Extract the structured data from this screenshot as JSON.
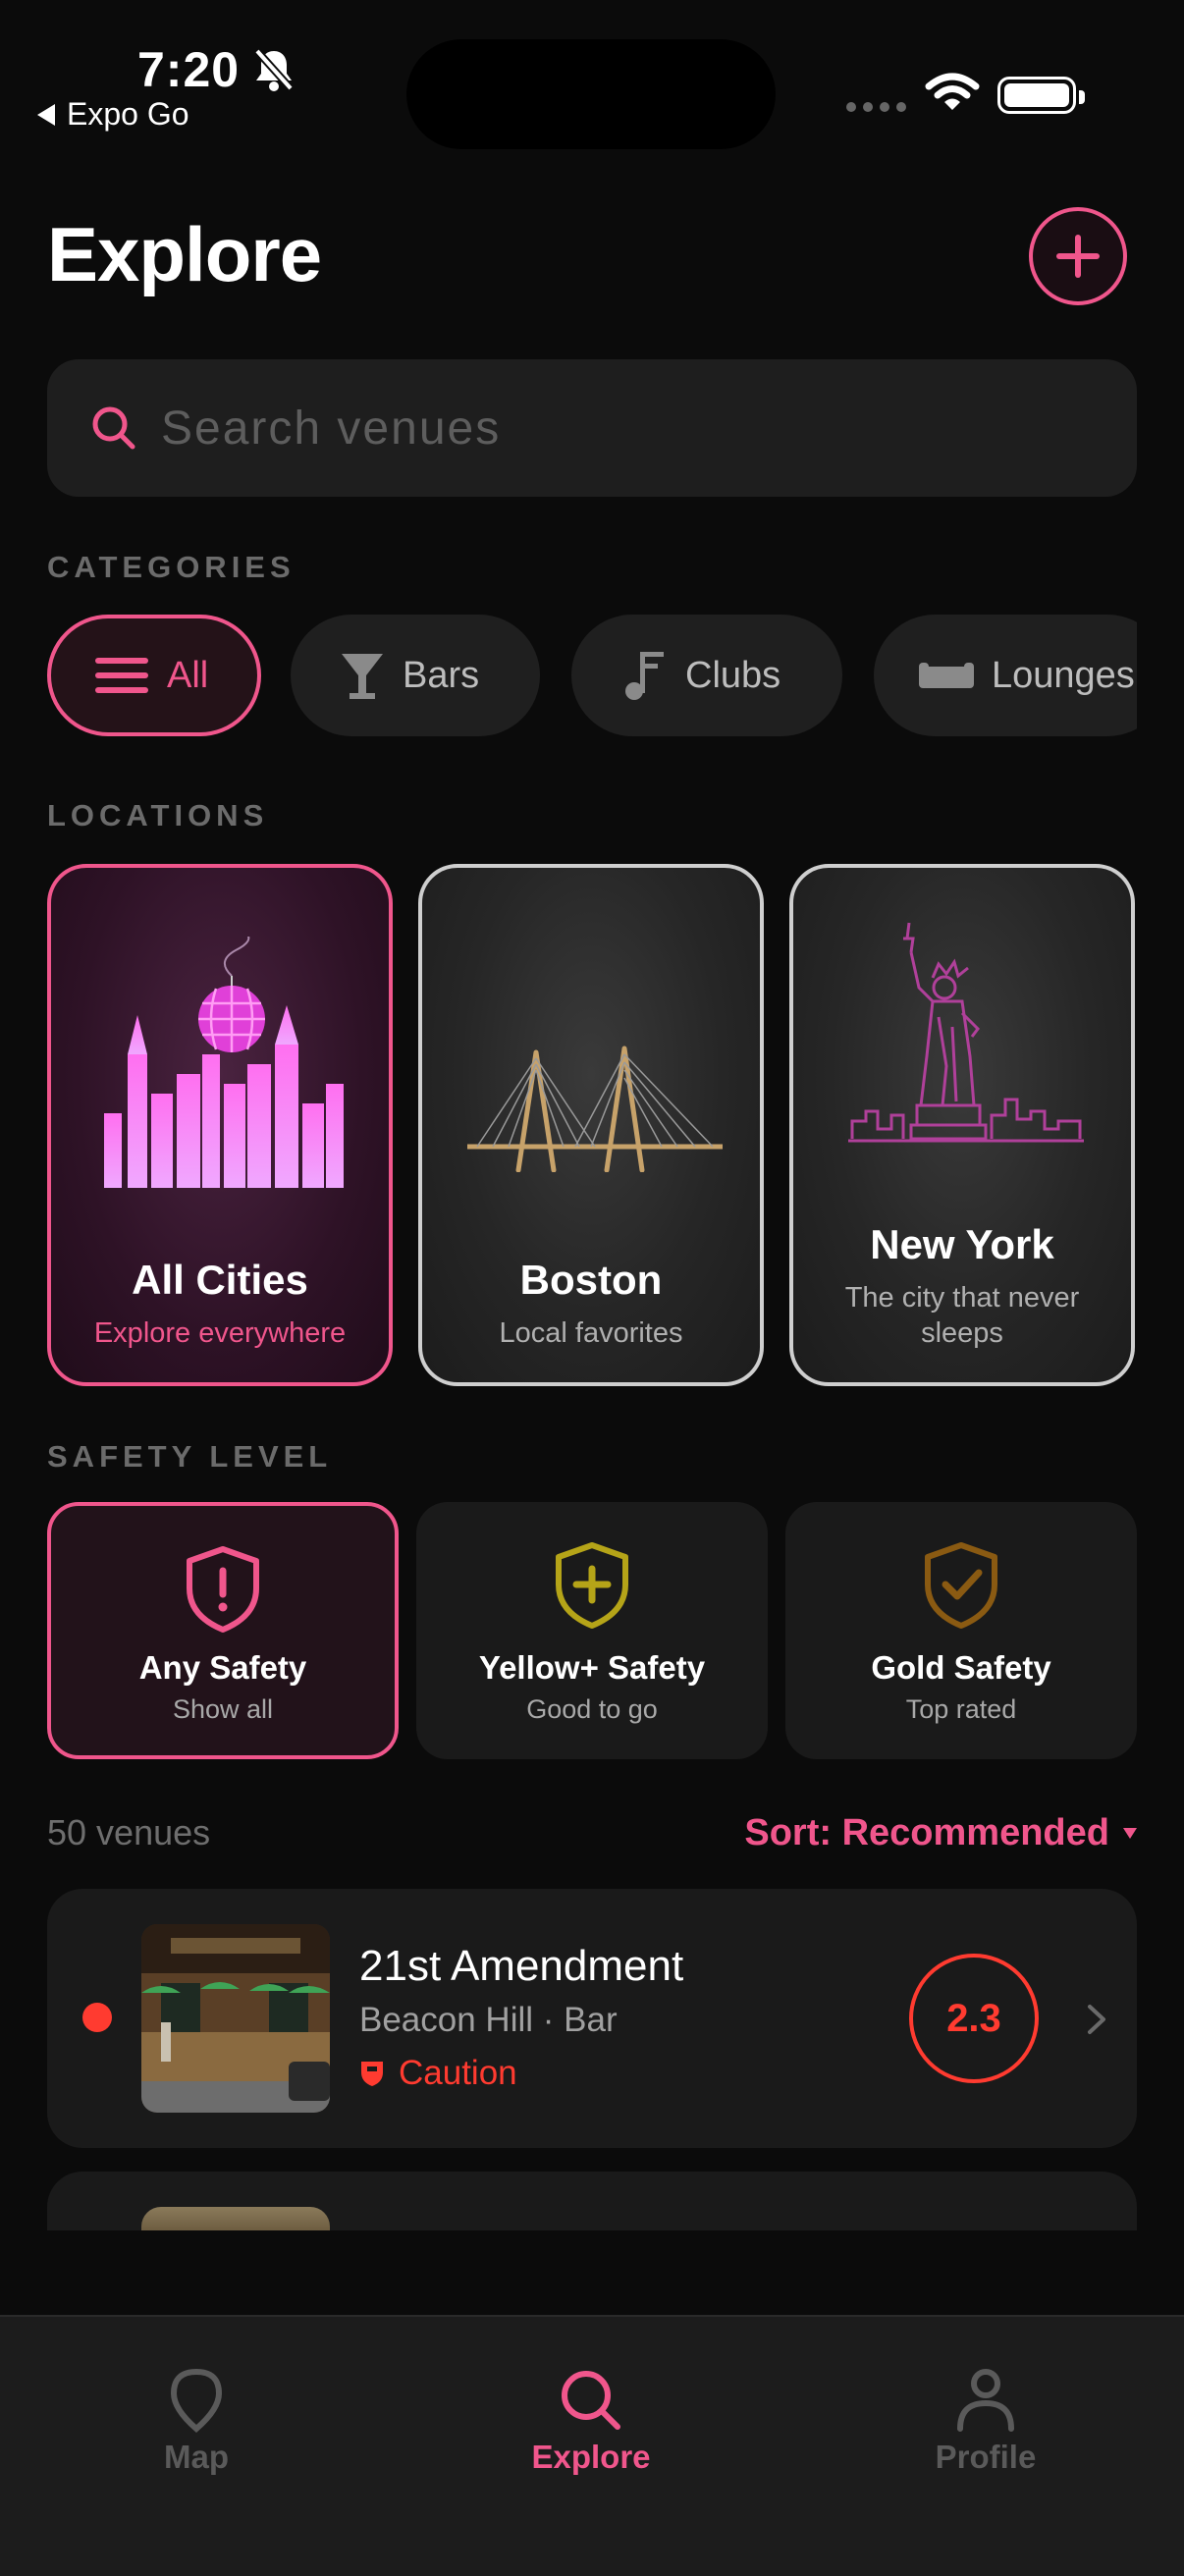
{
  "status_bar": {
    "time": "7:20",
    "back_app": "Expo Go"
  },
  "header": {
    "title": "Explore"
  },
  "search": {
    "placeholder": "Search venues"
  },
  "categories": {
    "label": "CATEGORIES",
    "items": [
      {
        "label": "All",
        "icon": "menu-icon",
        "active": true
      },
      {
        "label": "Bars",
        "icon": "martini-glass-icon"
      },
      {
        "label": "Clubs",
        "icon": "music-note-icon"
      },
      {
        "label": "Lounges",
        "icon": "sofa-icon"
      }
    ]
  },
  "locations": {
    "label": "LOCATIONS",
    "items": [
      {
        "name": "All Cities",
        "subtitle": "Explore everywhere",
        "active": true
      },
      {
        "name": "Boston",
        "subtitle": "Local favorites"
      },
      {
        "name": "New York",
        "subtitle": "The city that never sleeps"
      }
    ]
  },
  "safety": {
    "label": "SAFETY LEVEL",
    "items": [
      {
        "name": "Any Safety",
        "subtitle": "Show all",
        "active": true,
        "color": "#f0568c"
      },
      {
        "name": "Yellow+ Safety",
        "subtitle": "Good to go",
        "color": "#b5a418"
      },
      {
        "name": "Gold Safety",
        "subtitle": "Top rated",
        "color": "#8a5a12"
      }
    ]
  },
  "results": {
    "count": "50 venues",
    "sort": "Sort: Recommended"
  },
  "venues": [
    {
      "name": "21st Amendment",
      "meta": "Beacon Hill · Bar",
      "safety": "Caution",
      "score": "2.3",
      "status_color": "#ff3b30"
    }
  ],
  "tabs": [
    {
      "label": "Map",
      "icon": "map-pin-icon"
    },
    {
      "label": "Explore",
      "icon": "search-icon",
      "active": true
    },
    {
      "label": "Profile",
      "icon": "person-icon"
    }
  ],
  "colors": {
    "accent": "#f0568c",
    "danger": "#ff3b30",
    "background": "#0b0b0b"
  }
}
